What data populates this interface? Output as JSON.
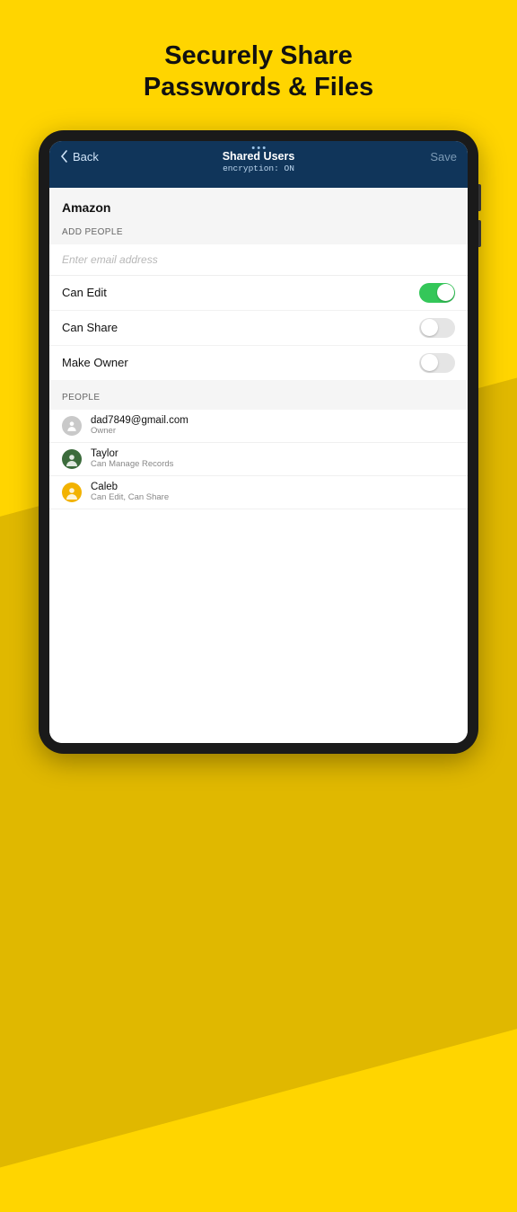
{
  "hero": {
    "line1": "Securely Share",
    "line2": "Passwords & Files"
  },
  "nav": {
    "back_label": "Back",
    "title": "Shared Users",
    "subtitle": "encryption: ON",
    "save_label": "Save"
  },
  "account": {
    "name": "Amazon"
  },
  "sections": {
    "add_people_label": "ADD PEOPLE",
    "people_label": "PEOPLE"
  },
  "email_placeholder": "Enter email address",
  "permissions": [
    {
      "label": "Can Edit",
      "on": true
    },
    {
      "label": "Can Share",
      "on": false
    },
    {
      "label": "Make Owner",
      "on": false
    }
  ],
  "people": [
    {
      "name": "dad7849@gmail.com",
      "role": "Owner",
      "avatar_bg": "#c9c9c9",
      "avatar_kind": "placeholder"
    },
    {
      "name": "Taylor",
      "role": "Can Manage Records",
      "avatar_bg": "#3b6b3b",
      "avatar_kind": "photo"
    },
    {
      "name": "Caleb",
      "role": "Can Edit, Can Share",
      "avatar_bg": "#f2b200",
      "avatar_kind": "photo"
    }
  ]
}
